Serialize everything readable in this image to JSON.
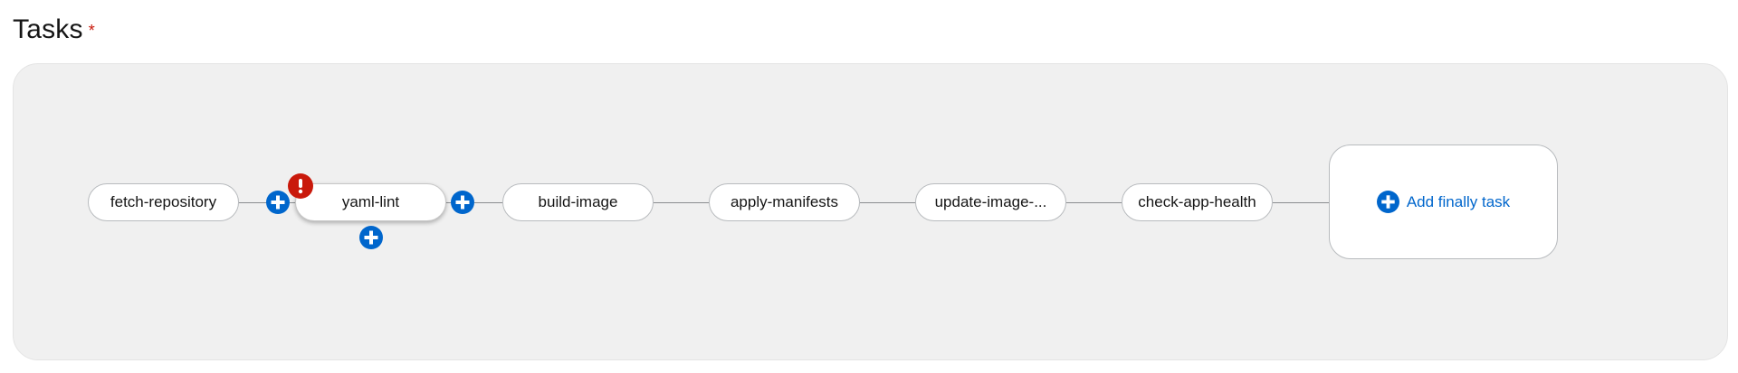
{
  "section": {
    "title": "Tasks",
    "required_marker": "*"
  },
  "pipeline": {
    "tasks": [
      {
        "label": "fetch-repository"
      },
      {
        "label": "yaml-lint",
        "selected": true,
        "has_error": true
      },
      {
        "label": "build-image"
      },
      {
        "label": "apply-manifests"
      },
      {
        "label": "update-image-..."
      },
      {
        "label": "check-app-health"
      }
    ],
    "add_finally_label": "Add finally task"
  },
  "icons": {
    "add": "plus-circle-icon",
    "error": "exclamation-circle-icon"
  },
  "colors": {
    "accent": "#0066cc",
    "error": "#c9190b",
    "canvas_bg": "#f0f0f0",
    "edge": "#8a8d90"
  }
}
